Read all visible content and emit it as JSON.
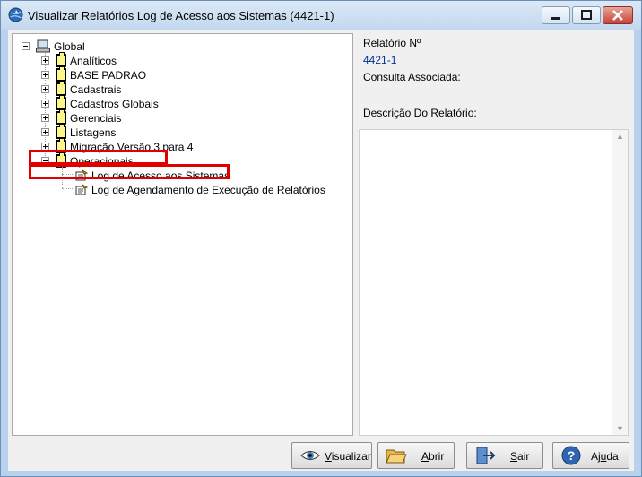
{
  "window": {
    "title": "Visualizar Relatórios Log de Acesso aos Sistemas (4421-1)"
  },
  "tree": {
    "root": {
      "label": "Global",
      "icon": "computer-icon"
    },
    "folders": [
      {
        "label": "Analíticos",
        "expanded": false
      },
      {
        "label": "BASE PADRAO",
        "expanded": false
      },
      {
        "label": "Cadastrais",
        "expanded": false
      },
      {
        "label": "Cadastros Globais",
        "expanded": false
      },
      {
        "label": "Gerenciais",
        "expanded": false
      },
      {
        "label": "Listagens",
        "expanded": false
      },
      {
        "label": "Migração Versão 3 para 4",
        "expanded": false
      },
      {
        "label": "Operacionais",
        "expanded": true
      }
    ],
    "reports": [
      {
        "label": "Log de Acesso aos Sistemas",
        "selected": true
      },
      {
        "label": "Log de Agendamento de Execução de Relatórios",
        "selected": false
      }
    ],
    "highlight_color": "#e00000"
  },
  "info": {
    "report_number_label": "Relatório Nº",
    "report_number_value": "4421-1",
    "query_label": "Consulta Associada:",
    "description_label": "Descrição Do Relatório:"
  },
  "buttons": {
    "visualizar": {
      "label_first": "V",
      "label_rest": "isualizar"
    },
    "abrir": {
      "label_first": "A",
      "label_rest": "brir"
    },
    "sair": {
      "label_first": "S",
      "label_rest": "air"
    },
    "ajuda": {
      "label_first": "Aj",
      "label_u": "u",
      "label_rest": "da"
    }
  }
}
